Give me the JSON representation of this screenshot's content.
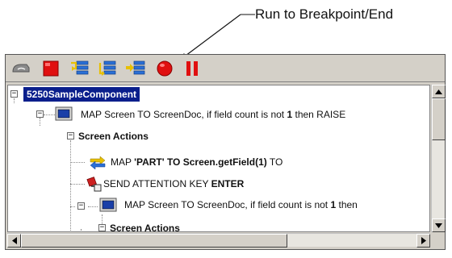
{
  "callout": {
    "label": "Run to Breakpoint/End"
  },
  "toolbar": {
    "buttons": [
      {
        "name": "disconnect",
        "icon": "disconnect-icon"
      },
      {
        "name": "stop",
        "icon": "stop-icon"
      },
      {
        "name": "step-into",
        "icon": "step-into-icon"
      },
      {
        "name": "step-over",
        "icon": "step-over-icon"
      },
      {
        "name": "run-to-breakpoint",
        "icon": "run-to-breakpoint-icon"
      },
      {
        "name": "toggle-breakpoint",
        "icon": "breakpoint-icon"
      },
      {
        "name": "pause",
        "icon": "pause-icon"
      }
    ]
  },
  "tree": {
    "root": "5250SampleComponent",
    "nodes": [
      {
        "prefix": "MAP Screen TO ScreenDoc, if field count is not ",
        "bold": "1",
        "suffix": " then RAISE"
      },
      {
        "label": "Screen Actions"
      },
      {
        "prefix": "MAP ",
        "bold": "'PART' TO Screen.getField(1)",
        "suffix": " TO"
      },
      {
        "prefix": "SEND ATTENTION KEY ",
        "bold": "ENTER",
        "suffix": ""
      },
      {
        "prefix": "MAP Screen TO ScreenDoc, if field count is not ",
        "bold": "1",
        "suffix": " then"
      },
      {
        "label": "Screen Actions"
      }
    ]
  },
  "colors": {
    "selection": "#0a1f8c",
    "stop": "#e01010",
    "breakpoint": "#e01010",
    "step": "#2a6fd6"
  }
}
